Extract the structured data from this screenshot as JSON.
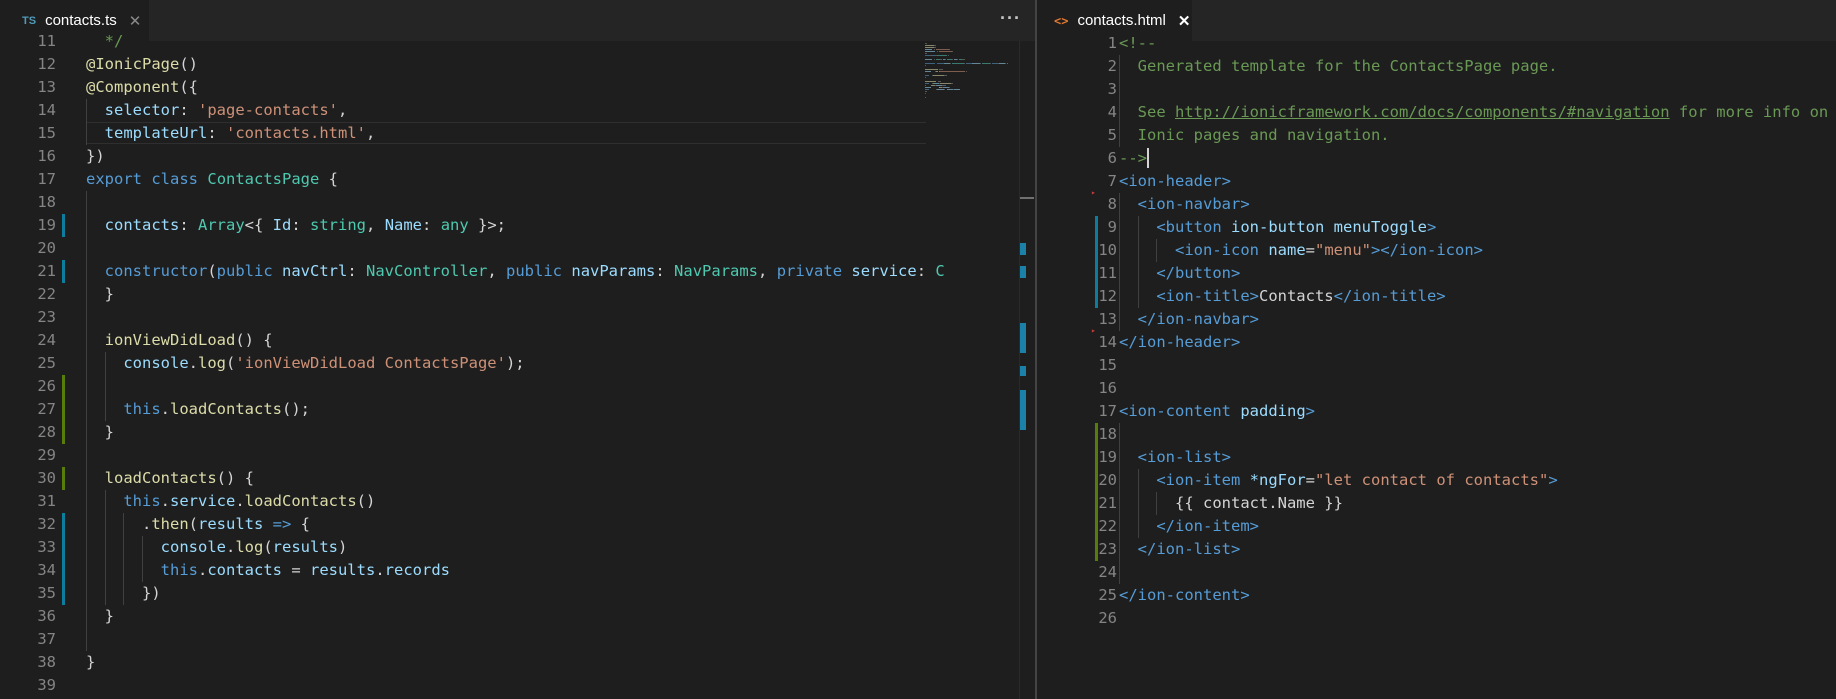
{
  "left_editor": {
    "tab": {
      "icon": "TS",
      "label": "contacts.ts"
    },
    "more_actions_label": "···",
    "lines": [
      {
        "n": "11",
        "tokens": [
          {
            "t": "  */",
            "c": "com"
          }
        ]
      },
      {
        "n": "12",
        "tokens": [
          {
            "t": "@IonicPage",
            "c": "dec"
          },
          {
            "t": "()",
            "c": "plain"
          }
        ]
      },
      {
        "n": "13",
        "tokens": [
          {
            "t": "@Component",
            "c": "dec"
          },
          {
            "t": "({",
            "c": "plain"
          }
        ]
      },
      {
        "n": "14",
        "tokens": [
          {
            "t": "  selector",
            "c": "prop"
          },
          {
            "t": ": ",
            "c": "plain"
          },
          {
            "t": "'page-contacts'",
            "c": "str"
          },
          {
            "t": ",",
            "c": "plain"
          }
        ]
      },
      {
        "n": "15",
        "tokens": [
          {
            "t": "  templateUrl",
            "c": "prop"
          },
          {
            "t": ": ",
            "c": "plain"
          },
          {
            "t": "'contacts.html'",
            "c": "str"
          },
          {
            "t": ",",
            "c": "plain"
          }
        ]
      },
      {
        "n": "16",
        "tokens": [
          {
            "t": "})",
            "c": "plain"
          }
        ]
      },
      {
        "n": "17",
        "tokens": [
          {
            "t": "export",
            "c": "kw"
          },
          {
            "t": " ",
            "c": "plain"
          },
          {
            "t": "class",
            "c": "kw"
          },
          {
            "t": " ",
            "c": "plain"
          },
          {
            "t": "ContactsPage",
            "c": "type"
          },
          {
            "t": " {",
            "c": "plain"
          }
        ]
      },
      {
        "n": "18",
        "tokens": []
      },
      {
        "n": "19",
        "tokens": [
          {
            "t": "  contacts",
            "c": "prop"
          },
          {
            "t": ": ",
            "c": "plain"
          },
          {
            "t": "Array",
            "c": "type"
          },
          {
            "t": "<{ ",
            "c": "plain"
          },
          {
            "t": "Id",
            "c": "prop"
          },
          {
            "t": ": ",
            "c": "plain"
          },
          {
            "t": "string",
            "c": "type"
          },
          {
            "t": ", ",
            "c": "plain"
          },
          {
            "t": "Name",
            "c": "prop"
          },
          {
            "t": ": ",
            "c": "plain"
          },
          {
            "t": "any",
            "c": "type"
          },
          {
            "t": " }>;",
            "c": "plain"
          }
        ]
      },
      {
        "n": "20",
        "tokens": []
      },
      {
        "n": "21",
        "tokens": [
          {
            "t": "  constructor",
            "c": "kw"
          },
          {
            "t": "(",
            "c": "plain"
          },
          {
            "t": "public",
            "c": "kw"
          },
          {
            "t": " ",
            "c": "plain"
          },
          {
            "t": "navCtrl",
            "c": "prop"
          },
          {
            "t": ": ",
            "c": "plain"
          },
          {
            "t": "NavController",
            "c": "type"
          },
          {
            "t": ", ",
            "c": "plain"
          },
          {
            "t": "public",
            "c": "kw"
          },
          {
            "t": " ",
            "c": "plain"
          },
          {
            "t": "navParams",
            "c": "prop"
          },
          {
            "t": ": ",
            "c": "plain"
          },
          {
            "t": "NavParams",
            "c": "type"
          },
          {
            "t": ", ",
            "c": "plain"
          },
          {
            "t": "private",
            "c": "kw"
          },
          {
            "t": " ",
            "c": "plain"
          },
          {
            "t": "service",
            "c": "prop"
          },
          {
            "t": ": ",
            "c": "plain"
          },
          {
            "t": "C",
            "c": "type"
          }
        ]
      },
      {
        "n": "22",
        "tokens": [
          {
            "t": "  }",
            "c": "plain"
          }
        ]
      },
      {
        "n": "23",
        "tokens": []
      },
      {
        "n": "24",
        "tokens": [
          {
            "t": "  ionViewDidLoad",
            "c": "fn"
          },
          {
            "t": "() {",
            "c": "plain"
          }
        ]
      },
      {
        "n": "25",
        "tokens": [
          {
            "t": "    console",
            "c": "prop"
          },
          {
            "t": ".",
            "c": "plain"
          },
          {
            "t": "log",
            "c": "fn"
          },
          {
            "t": "(",
            "c": "plain"
          },
          {
            "t": "'ionViewDidLoad ContactsPage'",
            "c": "str"
          },
          {
            "t": ");",
            "c": "plain"
          }
        ]
      },
      {
        "n": "26",
        "tokens": []
      },
      {
        "n": "27",
        "tokens": [
          {
            "t": "    this",
            "c": "kw"
          },
          {
            "t": ".",
            "c": "plain"
          },
          {
            "t": "loadContacts",
            "c": "fn"
          },
          {
            "t": "();",
            "c": "plain"
          }
        ]
      },
      {
        "n": "28",
        "tokens": [
          {
            "t": "  }",
            "c": "plain"
          }
        ]
      },
      {
        "n": "29",
        "tokens": []
      },
      {
        "n": "30",
        "tokens": [
          {
            "t": "  loadContacts",
            "c": "fn"
          },
          {
            "t": "() {",
            "c": "plain"
          }
        ]
      },
      {
        "n": "31",
        "tokens": [
          {
            "t": "    this",
            "c": "kw"
          },
          {
            "t": ".",
            "c": "plain"
          },
          {
            "t": "service",
            "c": "prop"
          },
          {
            "t": ".",
            "c": "plain"
          },
          {
            "t": "loadContacts",
            "c": "fn"
          },
          {
            "t": "()",
            "c": "plain"
          }
        ]
      },
      {
        "n": "32",
        "tokens": [
          {
            "t": "      .",
            "c": "plain"
          },
          {
            "t": "then",
            "c": "fn"
          },
          {
            "t": "(",
            "c": "plain"
          },
          {
            "t": "results",
            "c": "prop"
          },
          {
            "t": " ",
            "c": "plain"
          },
          {
            "t": "=>",
            "c": "kw"
          },
          {
            "t": " {",
            "c": "plain"
          }
        ]
      },
      {
        "n": "33",
        "tokens": [
          {
            "t": "        console",
            "c": "prop"
          },
          {
            "t": ".",
            "c": "plain"
          },
          {
            "t": "log",
            "c": "fn"
          },
          {
            "t": "(",
            "c": "plain"
          },
          {
            "t": "results",
            "c": "prop"
          },
          {
            "t": ")",
            "c": "plain"
          }
        ]
      },
      {
        "n": "34",
        "tokens": [
          {
            "t": "        this",
            "c": "kw"
          },
          {
            "t": ".",
            "c": "plain"
          },
          {
            "t": "contacts",
            "c": "prop"
          },
          {
            "t": " = ",
            "c": "plain"
          },
          {
            "t": "results",
            "c": "prop"
          },
          {
            "t": ".",
            "c": "plain"
          },
          {
            "t": "records",
            "c": "prop"
          }
        ]
      },
      {
        "n": "35",
        "tokens": [
          {
            "t": "      })",
            "c": "plain"
          }
        ]
      },
      {
        "n": "36",
        "tokens": [
          {
            "t": "  }",
            "c": "plain"
          }
        ]
      },
      {
        "n": "37",
        "tokens": []
      },
      {
        "n": "38",
        "tokens": [
          {
            "t": "}",
            "c": "plain"
          }
        ]
      },
      {
        "n": "39",
        "tokens": []
      }
    ]
  },
  "right_editor": {
    "tab": {
      "icon": "<>",
      "label": "contacts.html"
    },
    "lines": [
      {
        "n": "1",
        "tokens": [
          {
            "t": "<!--",
            "c": "com"
          }
        ]
      },
      {
        "n": "2",
        "tokens": [
          {
            "t": "  Generated template for the ContactsPage page.",
            "c": "com"
          }
        ]
      },
      {
        "n": "3",
        "tokens": []
      },
      {
        "n": "4",
        "tokens": [
          {
            "t": "  See ",
            "c": "com"
          },
          {
            "t": "http://ionicframework.com/docs/components/#navigation",
            "c": "url"
          },
          {
            "t": " for more info on",
            "c": "com"
          }
        ]
      },
      {
        "n": "5",
        "tokens": [
          {
            "t": "  Ionic pages and navigation.",
            "c": "com"
          }
        ]
      },
      {
        "n": "6",
        "tokens": [
          {
            "t": "-->",
            "c": "com"
          }
        ]
      },
      {
        "n": "7",
        "tokens": [
          {
            "t": "<ion-header",
            "c": "tag"
          },
          {
            "t": ">",
            "c": "tag"
          }
        ]
      },
      {
        "n": "8",
        "tokens": [
          {
            "t": "  <ion-navbar",
            "c": "tag"
          },
          {
            "t": ">",
            "c": "tag"
          }
        ]
      },
      {
        "n": "9",
        "tokens": [
          {
            "t": "    <button",
            "c": "tag"
          },
          {
            "t": " ",
            "c": "plain"
          },
          {
            "t": "ion-button",
            "c": "attr"
          },
          {
            "t": " ",
            "c": "plain"
          },
          {
            "t": "menuToggle",
            "c": "attr"
          },
          {
            "t": ">",
            "c": "tag"
          }
        ]
      },
      {
        "n": "10",
        "tokens": [
          {
            "t": "      <ion-icon",
            "c": "tag"
          },
          {
            "t": " ",
            "c": "plain"
          },
          {
            "t": "name",
            "c": "attr"
          },
          {
            "t": "=",
            "c": "plain"
          },
          {
            "t": "\"menu\"",
            "c": "str"
          },
          {
            "t": "></ion-icon>",
            "c": "tag"
          }
        ]
      },
      {
        "n": "11",
        "tokens": [
          {
            "t": "    </button>",
            "c": "tag"
          }
        ]
      },
      {
        "n": "12",
        "tokens": [
          {
            "t": "    <ion-title>",
            "c": "tag"
          },
          {
            "t": "Contacts",
            "c": "plain"
          },
          {
            "t": "</ion-title>",
            "c": "tag"
          }
        ]
      },
      {
        "n": "13",
        "tokens": [
          {
            "t": "  </ion-navbar>",
            "c": "tag"
          }
        ]
      },
      {
        "n": "14",
        "tokens": [
          {
            "t": "</ion-header>",
            "c": "tag"
          }
        ]
      },
      {
        "n": "15",
        "tokens": []
      },
      {
        "n": "16",
        "tokens": []
      },
      {
        "n": "17",
        "tokens": [
          {
            "t": "<ion-content",
            "c": "tag"
          },
          {
            "t": " ",
            "c": "plain"
          },
          {
            "t": "padding",
            "c": "attr"
          },
          {
            "t": ">",
            "c": "tag"
          }
        ]
      },
      {
        "n": "18",
        "tokens": []
      },
      {
        "n": "19",
        "tokens": [
          {
            "t": "  <ion-list>",
            "c": "tag"
          }
        ]
      },
      {
        "n": "20",
        "tokens": [
          {
            "t": "    <ion-item",
            "c": "tag"
          },
          {
            "t": " ",
            "c": "plain"
          },
          {
            "t": "*ngFor",
            "c": "attr"
          },
          {
            "t": "=",
            "c": "plain"
          },
          {
            "t": "\"let contact of contacts\"",
            "c": "str"
          },
          {
            "t": ">",
            "c": "tag"
          }
        ]
      },
      {
        "n": "21",
        "tokens": [
          {
            "t": "      {{ contact.Name }}",
            "c": "plain"
          }
        ]
      },
      {
        "n": "22",
        "tokens": [
          {
            "t": "    </ion-item>",
            "c": "tag"
          }
        ]
      },
      {
        "n": "23",
        "tokens": [
          {
            "t": "  </ion-list>",
            "c": "tag"
          }
        ]
      },
      {
        "n": "24",
        "tokens": []
      },
      {
        "n": "25",
        "tokens": [
          {
            "t": "</ion-content>",
            "c": "tag"
          }
        ]
      },
      {
        "n": "26",
        "tokens": []
      }
    ]
  },
  "colors": {
    "editor_background": "#1e1e1e",
    "tab_bar_background": "#252526",
    "modified_marker": "#0c7d9d",
    "added_marker": "#587c0c"
  },
  "icons": [
    "typescript-file-icon",
    "html-file-icon",
    "close-icon",
    "more-actions-icon"
  ]
}
